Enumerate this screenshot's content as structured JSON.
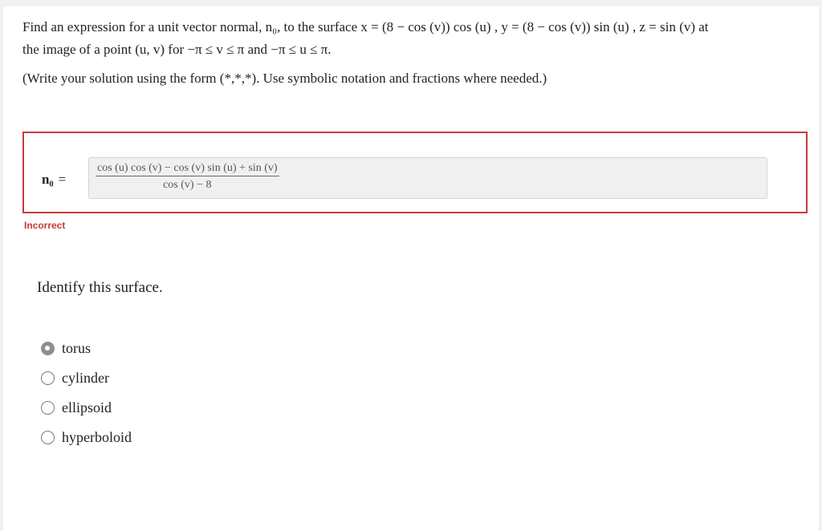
{
  "question": {
    "line1": "Find an expression for a unit vector normal, n₀, to the surface x = (8 − cos (v)) cos (u) , y = (8 − cos (v)) sin (u) , z = sin (v) at",
    "line2": "the image of a point (u, v) for −π ≤ v ≤ π and −π ≤ u ≤ π.",
    "instruction": "(Write your solution using the form (*,*,*). Use symbolic notation and fractions where needed.)"
  },
  "answer": {
    "label": "n₀",
    "equals": "=",
    "numerator": "cos (u) cos (v) − cos (v) sin (u) + sin (v)",
    "denominator": "cos (v) − 8",
    "status": "Incorrect",
    "status_color": "#c8393a"
  },
  "question2": {
    "prompt": "Identify this surface.",
    "options": [
      {
        "label": "torus",
        "selected": true
      },
      {
        "label": "cylinder",
        "selected": false
      },
      {
        "label": "ellipsoid",
        "selected": false
      },
      {
        "label": "hyperboloid",
        "selected": false
      }
    ]
  }
}
